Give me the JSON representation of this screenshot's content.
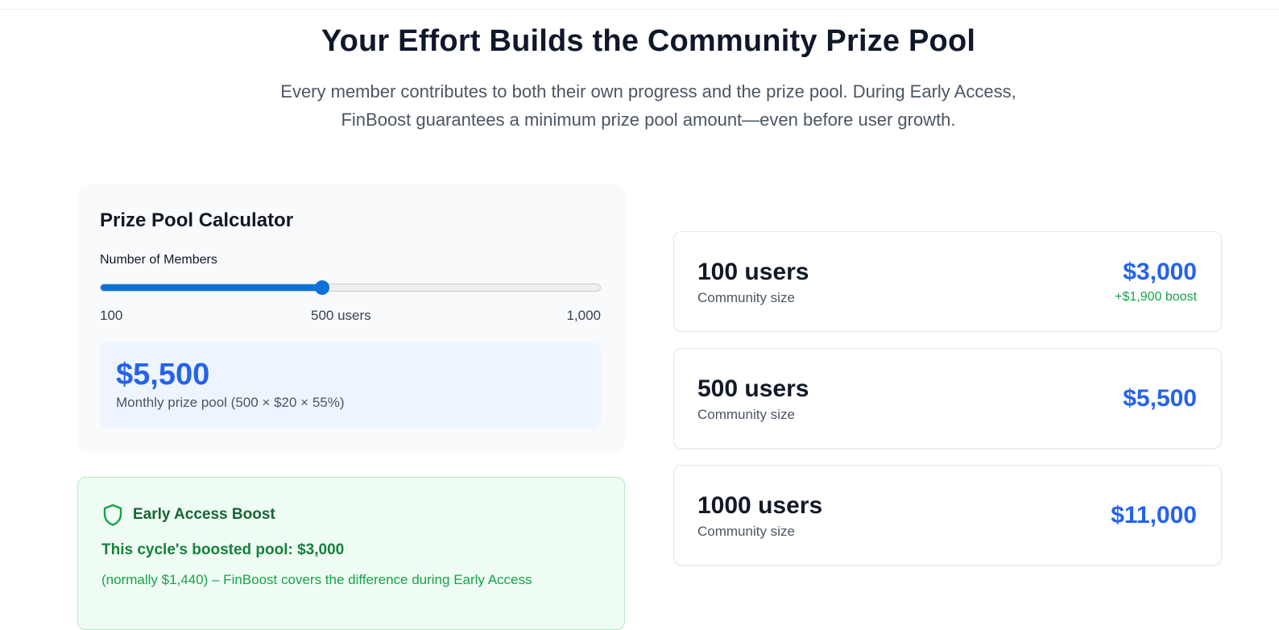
{
  "header": {
    "title": "Your Effort Builds the Community Prize Pool",
    "subtitle": "Every member contributes to both their own progress and the prize pool. During Early Access, FinBoost guarantees a minimum prize pool amount—even before user growth."
  },
  "calculator": {
    "title": "Prize Pool Calculator",
    "members_label": "Number of Members",
    "slider": {
      "min": 100,
      "max": 1000,
      "value": 500
    },
    "min_label": "100",
    "current_label": "500 users",
    "max_label": "1,000",
    "pool_amount": "$5,500",
    "pool_formula": "Monthly prize pool (500 × $20 × 55%)",
    "accent_color": "#0b72d9"
  },
  "boost": {
    "icon": "shield-icon",
    "title": "Early Access Boost",
    "pool_text": "This cycle's boosted pool: $3,000",
    "note": "(normally $1,440) – FinBoost covers the difference during Early Access"
  },
  "tiers": [
    {
      "users": "100 users",
      "label": "Community size",
      "amount": "$3,000",
      "boost": "+$1,900 boost"
    },
    {
      "users": "500 users",
      "label": "Community size",
      "amount": "$5,500"
    },
    {
      "users": "1000 users",
      "label": "Community size",
      "amount": "$11,000"
    }
  ],
  "colors": {
    "amount_blue": "#2563eb",
    "boost_green": "#16a34a",
    "boost_bg": "#effcf3"
  }
}
